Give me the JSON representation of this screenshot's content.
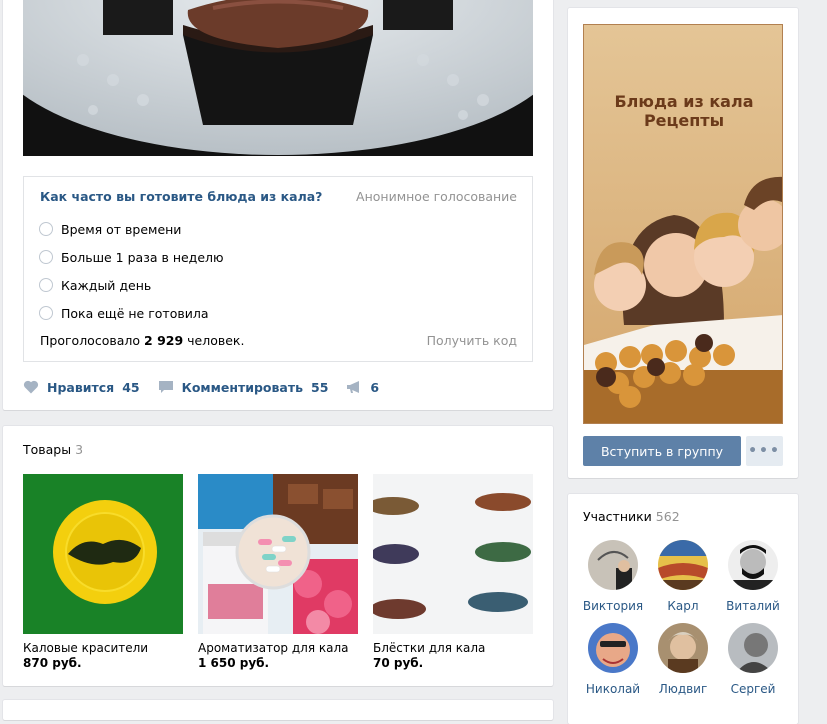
{
  "poll": {
    "question": "Как часто вы готовите блюда из кала?",
    "anonymous_label": "Анонимное голосование",
    "options": [
      "Время от времени",
      "Больше 1 раза в неделю",
      "Каждый день",
      "Пока ещё не готовила"
    ],
    "total_prefix": "Проголосовало",
    "total_count": "2 929",
    "total_suffix": "человек.",
    "get_code_label": "Получить код"
  },
  "actions": {
    "like_label": "Нравится",
    "like_count": "45",
    "comment_label": "Комментировать",
    "comment_count": "55",
    "share_count": "6"
  },
  "goods": {
    "title": "Товары",
    "count": "3",
    "items": [
      {
        "name": "Каловые красители",
        "price": "870 руб."
      },
      {
        "name": "Ароматизатор для кала",
        "price": "1 650 руб."
      },
      {
        "name": "Блёстки для кала",
        "price": "70 руб."
      }
    ]
  },
  "ad": {
    "title_line1": "Блюда из кала",
    "title_line2": "Рецепты"
  },
  "group": {
    "join_label": "Вступить в группу",
    "more_label": "•••"
  },
  "members": {
    "title": "Участники",
    "count": "562",
    "list": [
      "Виктория",
      "Карл",
      "Виталий",
      "Николай",
      "Людвиг",
      "Сергей"
    ]
  },
  "colors": {
    "link": "#2a5885",
    "button": "#5e81a8",
    "muted": "#939393"
  },
  "icons": {
    "like": "heart-icon",
    "comment": "comment-icon",
    "share": "megaphone-icon",
    "more": "more-dots-icon"
  }
}
